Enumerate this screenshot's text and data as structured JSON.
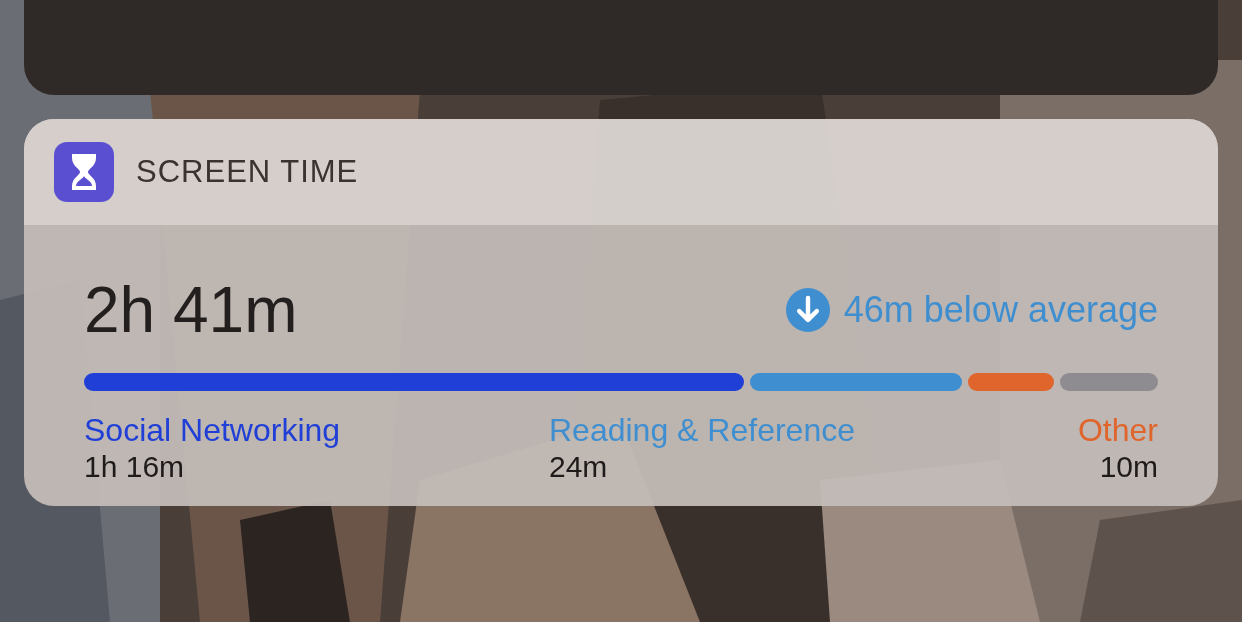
{
  "widget": {
    "title": "SCREEN TIME"
  },
  "total": "2h 41m",
  "comparison": {
    "text": "46m below average"
  },
  "segments": [
    {
      "color": "#1f3fd6"
    },
    {
      "color": "#3f8fd0"
    },
    {
      "color": "#e0652c"
    },
    {
      "color": "#8e8c90"
    }
  ],
  "categories": [
    {
      "label": "Social Networking",
      "value": "1h 16m",
      "color": "#1f3fd6"
    },
    {
      "label": "Reading & Reference",
      "value": "24m",
      "color": "#3f8fd0"
    },
    {
      "label": "Other",
      "value": "10m",
      "color": "#e0652c"
    }
  ]
}
